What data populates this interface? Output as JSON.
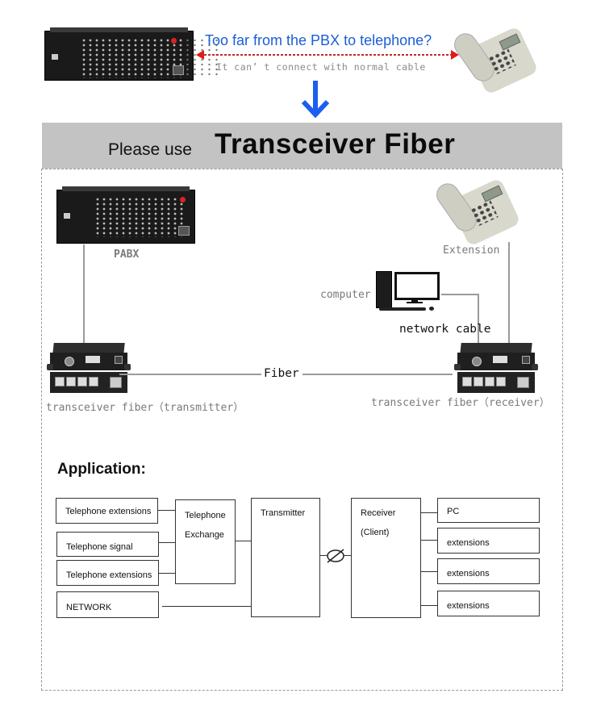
{
  "header": {
    "question": "Too far from the PBX to telephone?",
    "note": "It can’ t connect with normal cable",
    "arrow_color": "#e11b1b",
    "question_color": "#1a5fd6",
    "down_arrow_icon": "arrow-down-icon",
    "down_arrow_color": "#1b5ff0"
  },
  "banner": {
    "lead": "Please use",
    "product": "Transceiver Fiber",
    "background": "#c3c3c3"
  },
  "topology": {
    "pabx_label": "PABX",
    "extension_label": "Extension",
    "computer_label": "computer",
    "network_cable_label": "network cable",
    "fiber_label": "Fiber",
    "transmitter_label": "transceiver fiber（transmitter）",
    "receiver_label": "transceiver fiber（receiver）"
  },
  "application": {
    "title": "Application:",
    "inputs": [
      "Telephone extensions",
      "Telephone signal",
      "Telephone extensions",
      "NETWORK"
    ],
    "exchange": [
      "Telephone",
      "Exchange"
    ],
    "transmitter": "Transmitter",
    "fiber_symbol": "⌀",
    "receiver": [
      "Receiver",
      "(Client)"
    ],
    "outputs": [
      "PC",
      "extensions",
      "extensions",
      "extensions"
    ]
  }
}
